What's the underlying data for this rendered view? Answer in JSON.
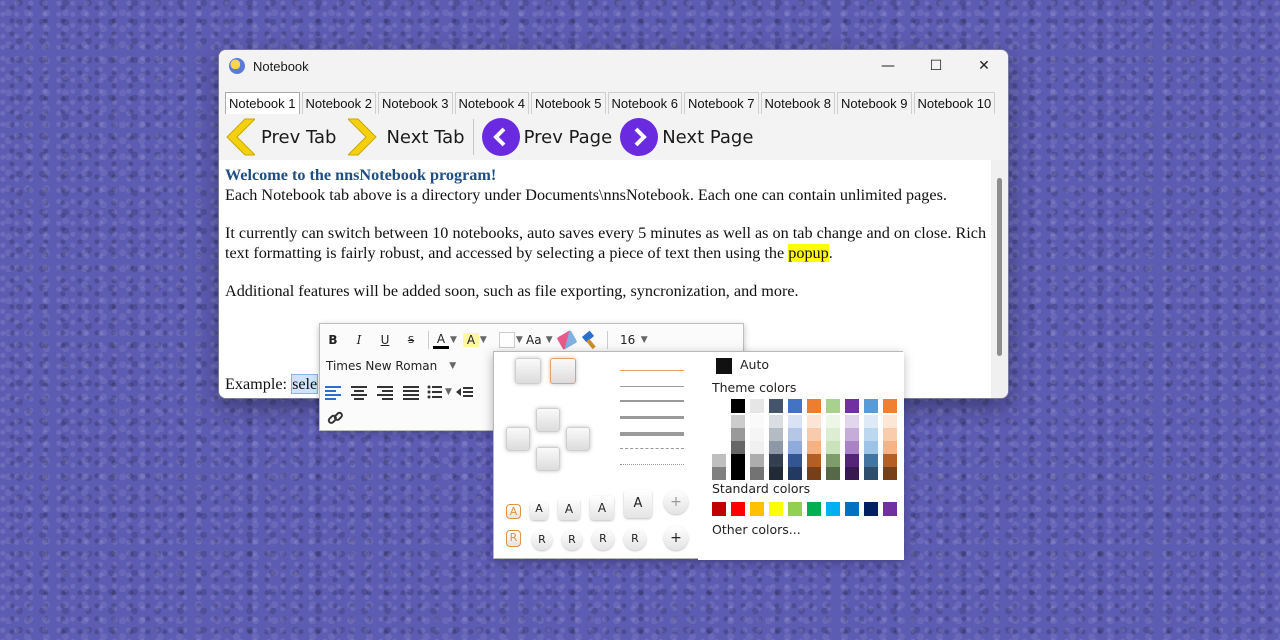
{
  "window": {
    "title": "Notebook",
    "controls": {
      "minimize": "—",
      "maximize": "☐",
      "close": "✕"
    }
  },
  "tabs": [
    "Notebook 1",
    "Notebook 2",
    "Notebook 3",
    "Notebook 4",
    "Notebook 5",
    "Notebook 6",
    "Notebook 7",
    "Notebook 8",
    "Notebook 9",
    "Notebook 10"
  ],
  "toolbar": {
    "prev_tab": "Prev Tab",
    "next_tab": "Next Tab",
    "prev_page": "Prev Page",
    "next_page": "Next Page",
    "chevron_color": "#f5d10d",
    "page_circle_color": "#6a2be0"
  },
  "content": {
    "heading": "Welcome to the nnsNotebook program!",
    "p1": "Each Notebook tab above is a directory under Documents\\nnsNotebook. Each one can contain unlimited pages.",
    "p2_a": "It currently can switch between 10 notebooks, auto saves every 5 minutes as well as on tab change and on close. Rich text formatting is fairly robust, and accessed by selecting a piece of text then using the ",
    "p2_highlight": "popup",
    "p2_end": ".",
    "p3": "Additional features will be added soon, such as file exporting, syncronization, and more.",
    "example_label": "Example: ",
    "example_selected": "sele"
  },
  "format_popup": {
    "bold": "B",
    "italic": "I",
    "underline": "U",
    "strike": "S",
    "font_color_glyph": "A",
    "highlight_glyph": "A",
    "case_glyph": "Aa",
    "font_size": "16",
    "font_name": "Times New Roman"
  },
  "color_picker": {
    "auto_label": "Auto",
    "theme_label": "Theme colors",
    "standard_label": "Standard colors",
    "other_label": "Other colors...",
    "theme_top": [
      "#ffffff",
      "#000000",
      "#e7e6e6",
      "#44546a",
      "#4472c4",
      "#ed7d31",
      "#a9d18e",
      "#7030a0",
      "#5b9bd5",
      "#f08030"
    ],
    "standard": [
      "#c00000",
      "#ff0000",
      "#ffc000",
      "#ffff00",
      "#92d050",
      "#00b050",
      "#00b0f0",
      "#0070c0",
      "#002060",
      "#7030a0"
    ]
  },
  "style_panel": {
    "a_row": [
      "A",
      "A",
      "A",
      "A",
      "A",
      "+"
    ],
    "r_row": [
      "R",
      "R",
      "R",
      "R",
      "R",
      "+"
    ]
  }
}
